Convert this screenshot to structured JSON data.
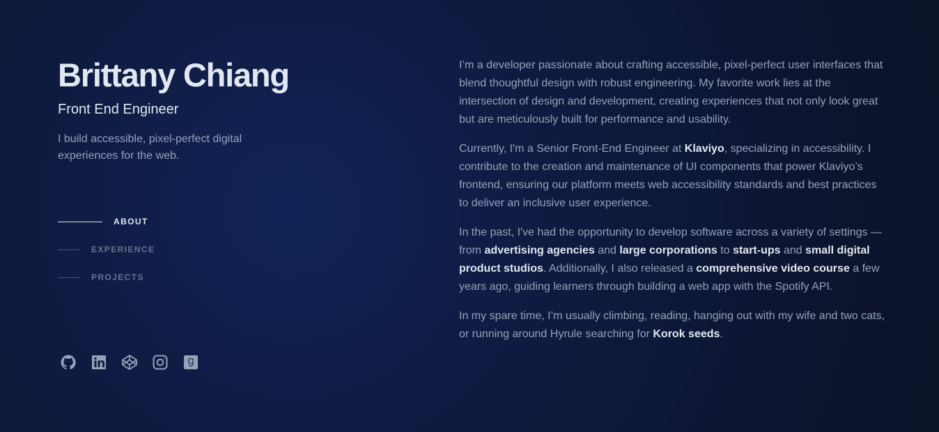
{
  "header": {
    "name": "Brittany Chiang",
    "role": "Front End Engineer",
    "tagline": "I build accessible, pixel-perfect digital experiences for the web."
  },
  "nav": {
    "items": [
      {
        "label": "About",
        "active": true
      },
      {
        "label": "Experience",
        "active": false
      },
      {
        "label": "Projects",
        "active": false
      }
    ]
  },
  "socials": [
    {
      "name": "GitHub",
      "icon": "github-icon"
    },
    {
      "name": "LinkedIn",
      "icon": "linkedin-icon"
    },
    {
      "name": "CodePen",
      "icon": "codepen-icon"
    },
    {
      "name": "Instagram",
      "icon": "instagram-icon"
    },
    {
      "name": "Goodreads",
      "icon": "goodreads-icon"
    }
  ],
  "about": {
    "p1": "I’m a developer passionate about crafting accessible, pixel-perfect user interfaces that blend thoughtful design with robust engineering. My favorite work lies at the intersection of design and development, creating experiences that not only look great but are meticulously built for performance and usability.",
    "p2": {
      "t1": "Currently, I'm a Senior Front-End Engineer at ",
      "klaviyo": "Klaviyo",
      "t2": ", specializing in accessibility. I contribute to the creation and maintenance of UI components that power Klaviyo’s frontend, ensuring our platform meets web accessibility standards and best practices to deliver an inclusive user experience."
    },
    "p3": {
      "t1": "In the past, I've had the opportunity to develop software across a variety of settings — from ",
      "l1": "advertising agencies",
      "t2": " and ",
      "l2": "large corporations",
      "t3": " to ",
      "l3": "start-ups",
      "t4": " and ",
      "l4": "small digital product studios",
      "t5": ". Additionally, I also released a ",
      "l5": "comprehensive video course",
      "t6": " a few years ago, guiding learners through building a web app with the Spotify API."
    },
    "p4": {
      "t1": "In my spare time, I’m usually climbing, reading, hanging out with my wife and two cats, or running around Hyrule searching for ",
      "l1": "Korok seeds",
      "t2": "."
    }
  },
  "colors": {
    "background": "#0f172a",
    "heading": "#e2e8f0",
    "body": "#94a3b8",
    "muted": "#64748b"
  }
}
